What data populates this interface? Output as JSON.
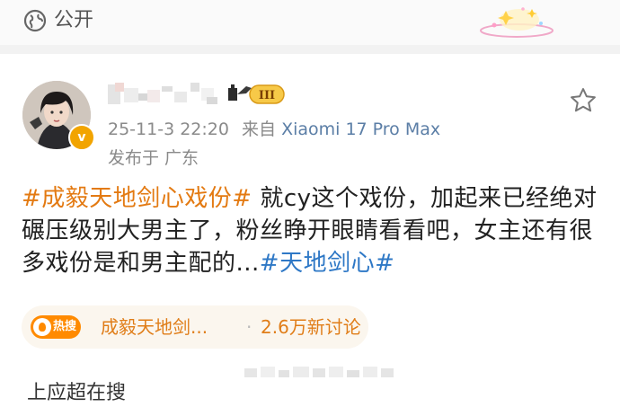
{
  "header": {
    "visibility_label": "公开"
  },
  "post": {
    "author": {
      "verified_mark": "v",
      "level": "III"
    },
    "timestamp": "25-11-3 22:20",
    "source_prefix": "来自",
    "device": "Xiaomi 17 Pro Max",
    "location": "发布于 广东",
    "body": {
      "hashtag_1": "#成毅天地剑心戏份#",
      "text": " 就cy这个戏份，加起来已经绝对碾压级别大男主了，粉丝睁开眼睛看看吧，女主还有很多戏份是和男主配的...",
      "hashtag_2": "#天地剑心#"
    }
  },
  "hot_search": {
    "badge_label": "热搜",
    "topic": "成毅天地剑...",
    "separator": "·",
    "count_text": "2.6万新讨论"
  },
  "footer": {
    "partial_text": "上应超在搜"
  },
  "colors": {
    "hashtag_orange": "#e37a12",
    "hashtag_blue": "#2e78c6",
    "hot_badge": "#ff8a00",
    "device_link": "#5b7ea6",
    "verified": "#f2a400"
  }
}
